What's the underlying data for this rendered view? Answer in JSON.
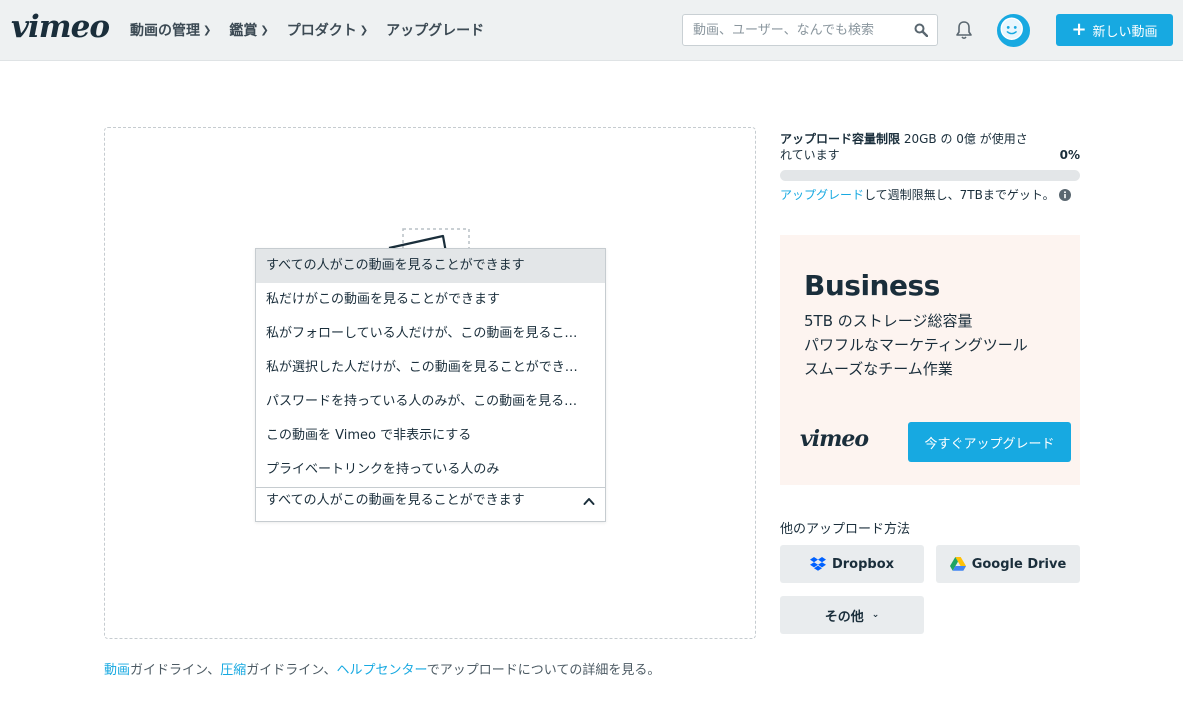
{
  "header": {
    "logo": "vimeo",
    "nav": [
      {
        "label": "動画の管理",
        "has_dropdown": true
      },
      {
        "label": "鑑賞",
        "has_dropdown": true
      },
      {
        "label": "プロダクト",
        "has_dropdown": true
      },
      {
        "label": "アップグレード",
        "has_dropdown": false
      }
    ],
    "search_placeholder": "動画、ユーザー、なんでも検索",
    "new_video_label": "新しい動画",
    "icons": {
      "search": "search-icon",
      "bell": "bell-icon",
      "avatar": "avatar-face",
      "plus": "plus-icon"
    }
  },
  "upload": {
    "privacy_options": [
      "すべての人がこの動画を見ることができます",
      "私だけがこの動画を見ることができます",
      "私がフォローしている人だけが、この動画を見ることができます",
      "私が選択した人だけが、この動画を見ることができます",
      "パスワードを持っている人のみが、この動画を見ることができます",
      "この動画を Vimeo で非表示にする",
      "プライベートリンクを持っている人のみ"
    ],
    "selected_index": 0,
    "current_value": "すべての人がこの動画を見ることができます",
    "guidelines": {
      "link1": "動画",
      "text1": "ガイドライン、",
      "link2": "圧縮",
      "text2": "ガイドライン、",
      "link3": "ヘルプセンター",
      "text3": "でアップロードについての詳細を見る。"
    }
  },
  "quota": {
    "label": "アップロード容量制限",
    "detail": " 20GB の 0億 が使用されています",
    "percent_text": "0%",
    "fill_fraction": 0.0,
    "upgrade_link": "アップグレード",
    "upgrade_text": "して週制限無し、7TBまでゲット。"
  },
  "promo": {
    "title": "Business",
    "lines": [
      "5TB のストレージ総容量",
      "パワフルなマーケティングツール",
      "スムーズなチーム作業"
    ],
    "logo": "vimeo",
    "button_label": "今すぐアップグレード"
  },
  "other_sources": {
    "title": "他のアップロード方法",
    "dropbox": "Dropbox",
    "gdrive": "Google Drive",
    "other": "その他"
  },
  "colors": {
    "accent": "#17a9e1",
    "text": "#1a2e3b",
    "promo_bg": "#fdf4f0"
  }
}
